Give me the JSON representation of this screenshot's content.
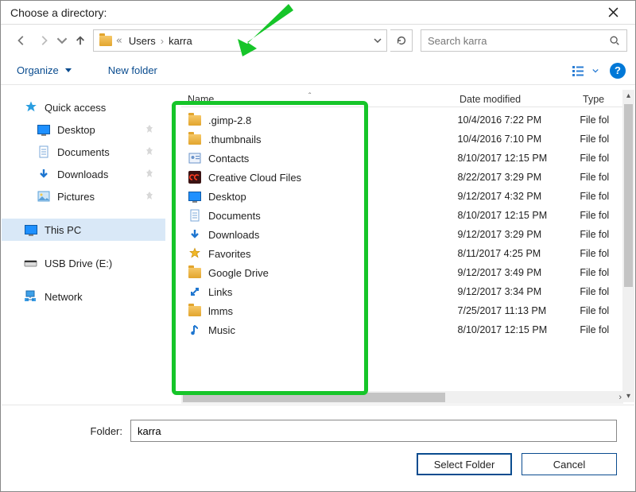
{
  "title": "Choose a directory:",
  "breadcrumb": {
    "lead": "«",
    "segments": [
      "Users",
      "karra"
    ]
  },
  "search": {
    "placeholder": "Search karra"
  },
  "toolbar": {
    "organize": "Organize",
    "newfolder": "New folder"
  },
  "sidebar": {
    "quick_access": "Quick access",
    "items": [
      {
        "label": "Desktop",
        "icon": "desktop"
      },
      {
        "label": "Documents",
        "icon": "documents"
      },
      {
        "label": "Downloads",
        "icon": "downloads"
      },
      {
        "label": "Pictures",
        "icon": "pictures"
      }
    ],
    "thispc": "This PC",
    "usb": "USB Drive (E:)",
    "network": "Network"
  },
  "columns": {
    "name": "Name",
    "date": "Date modified",
    "type": "Type"
  },
  "rows": [
    {
      "name": ".gimp-2.8",
      "icon": "folder",
      "date": "10/4/2016 7:22 PM",
      "type": "File fol"
    },
    {
      "name": ".thumbnails",
      "icon": "folder",
      "date": "10/4/2016 7:10 PM",
      "type": "File fol"
    },
    {
      "name": "Contacts",
      "icon": "contacts",
      "date": "8/10/2017 12:15 PM",
      "type": "File fol"
    },
    {
      "name": "Creative Cloud Files",
      "icon": "cc",
      "date": "8/22/2017 3:29 PM",
      "type": "File fol"
    },
    {
      "name": "Desktop",
      "icon": "desktop",
      "date": "9/12/2017 4:32 PM",
      "type": "File fol"
    },
    {
      "name": "Documents",
      "icon": "documents",
      "date": "8/10/2017 12:15 PM",
      "type": "File fol"
    },
    {
      "name": "Downloads",
      "icon": "downloads",
      "date": "9/12/2017 3:29 PM",
      "type": "File fol"
    },
    {
      "name": "Favorites",
      "icon": "star",
      "date": "8/11/2017 4:25 PM",
      "type": "File fol"
    },
    {
      "name": "Google Drive",
      "icon": "folder",
      "date": "9/12/2017 3:49 PM",
      "type": "File fol"
    },
    {
      "name": "Links",
      "icon": "link",
      "date": "9/12/2017 3:34 PM",
      "type": "File fol"
    },
    {
      "name": "lmms",
      "icon": "folder",
      "date": "7/25/2017 11:13 PM",
      "type": "File fol"
    },
    {
      "name": "Music",
      "icon": "music",
      "date": "8/10/2017 12:15 PM",
      "type": "File fol"
    }
  ],
  "folder_label": "Folder:",
  "folder_value": "karra",
  "buttons": {
    "select": "Select Folder",
    "cancel": "Cancel"
  }
}
